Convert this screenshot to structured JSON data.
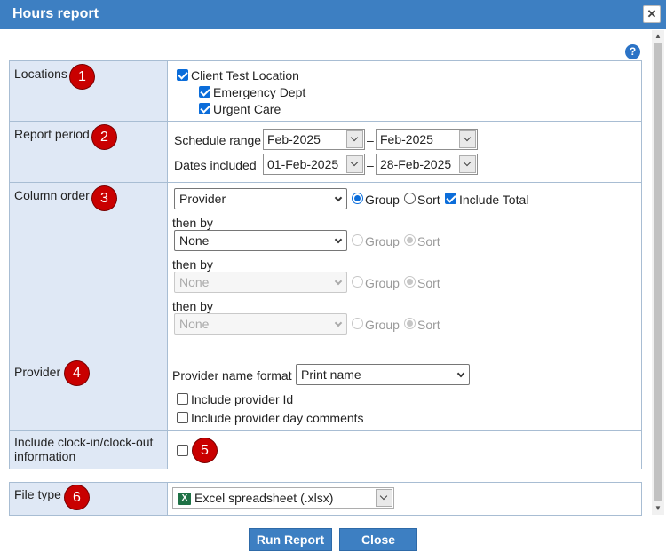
{
  "window": {
    "title": "Hours report",
    "close_icon": "close-icon",
    "help_icon": "help-icon",
    "help_glyph": "?"
  },
  "badges": [
    "1",
    "2",
    "3",
    "4",
    "5",
    "6"
  ],
  "locations": {
    "label": "Locations",
    "items": [
      {
        "label": "Client Test Location",
        "checked": true
      },
      {
        "label": "Emergency Dept",
        "checked": true
      },
      {
        "label": "Urgent Care",
        "checked": true
      }
    ]
  },
  "report_period": {
    "label": "Report period",
    "schedule_range_label": "Schedule range",
    "schedule_from": "Feb-2025",
    "schedule_to": "Feb-2025",
    "dates_included_label": "Dates included",
    "dates_from": "01-Feb-2025",
    "dates_to": "28-Feb-2025",
    "dash": "–"
  },
  "column_order": {
    "label": "Column order",
    "then_by_label": "then by",
    "group_label": "Group",
    "sort_label": "Sort",
    "include_total_label": "Include Total",
    "rows": [
      {
        "value": "Provider",
        "group": true,
        "sort": false,
        "enabled": true
      },
      {
        "value": "None",
        "group": false,
        "sort": true,
        "enabled": true
      },
      {
        "value": "None",
        "group": false,
        "sort": true,
        "enabled": false
      },
      {
        "value": "None",
        "group": false,
        "sort": true,
        "enabled": false
      }
    ]
  },
  "provider": {
    "label": "Provider",
    "name_format_label": "Provider name format",
    "name_format_value": "Print name",
    "include_id_label": "Include provider Id",
    "include_comments_label": "Include provider day comments"
  },
  "clock": {
    "label": "Include clock-in/clock-out information"
  },
  "file_type": {
    "label": "File type",
    "value": "Excel spreadsheet (.xlsx)",
    "icon_glyph": "X"
  },
  "footer": {
    "run_label": "Run Report",
    "close_label": "Close"
  }
}
